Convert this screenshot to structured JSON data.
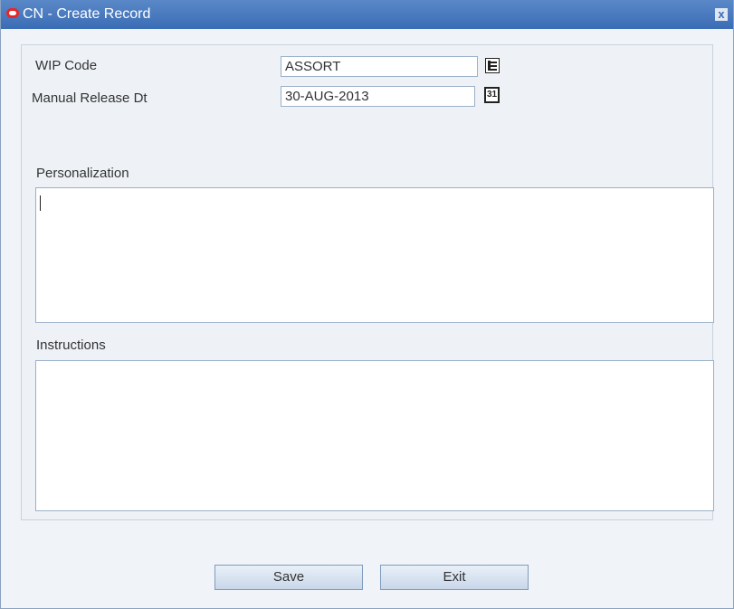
{
  "window": {
    "title": "CN - Create Record",
    "close_glyph": "x"
  },
  "form": {
    "wip_code": {
      "label": "WIP Code",
      "value": "ASSORT"
    },
    "manual_release_dt": {
      "label": "Manual Release Dt",
      "value": "30-AUG-2013"
    },
    "calendar_icon_text": "31",
    "personalization": {
      "label": "Personalization",
      "value": ""
    },
    "instructions": {
      "label": "Instructions",
      "value": ""
    }
  },
  "buttons": {
    "save": "Save",
    "exit": "Exit"
  },
  "colors": {
    "titlebar": "#3b6db5",
    "background": "#f0f3f8",
    "logo": "#e8262a"
  },
  "icons": [
    "oracle-logo-icon",
    "close-icon",
    "list-of-values-icon",
    "calendar-icon"
  ]
}
